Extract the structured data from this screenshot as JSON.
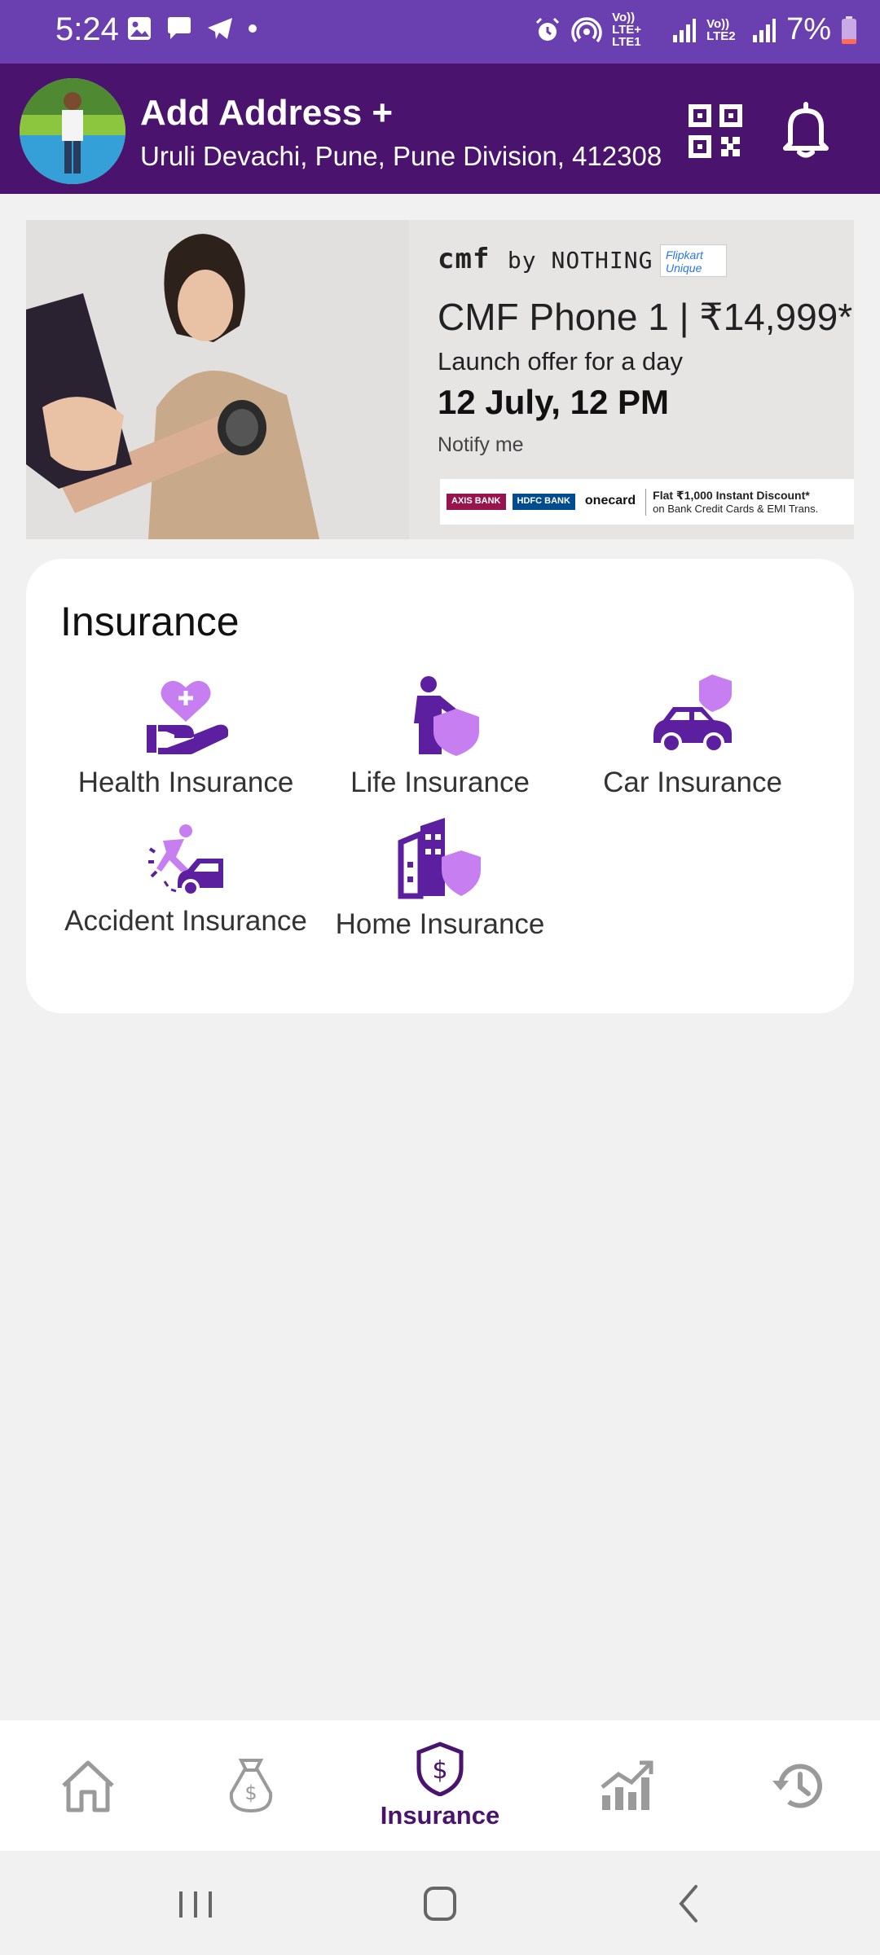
{
  "status_bar": {
    "time": "5:24",
    "network_1": "Vo)) LTE+ LTE1",
    "network_2": "Vo)) LTE2",
    "battery": "7%"
  },
  "header": {
    "title": "Add Address +",
    "address": "Uruli Devachi, Pune, Pune Division, 412308"
  },
  "banner": {
    "brand": "cmf",
    "brand_sub": "by NOTHING",
    "partner": "Flipkart Unique",
    "headline": "CMF Phone 1 | ₹14,999*",
    "subtitle": "Launch offer for a day",
    "date": "12 July, 12 PM",
    "notify": "Notify me",
    "banks": [
      "AXIS BANK",
      "HDFC BANK",
      "onecard"
    ],
    "offer_title": "Flat ₹1,000 Instant Discount*",
    "offer_sub": "on Bank Credit Cards & EMI Trans."
  },
  "insurance": {
    "title": "Insurance",
    "items": [
      {
        "label": "Health Insurance",
        "icon": "health-insurance-icon"
      },
      {
        "label": "Life Insurance",
        "icon": "life-insurance-icon"
      },
      {
        "label": "Car Insurance",
        "icon": "car-insurance-icon"
      },
      {
        "label": "Accident Insurance",
        "icon": "accident-insurance-icon"
      },
      {
        "label": "Home Insurance",
        "icon": "home-insurance-icon"
      }
    ]
  },
  "bottom_nav": {
    "items": [
      {
        "icon": "home-icon",
        "label": ""
      },
      {
        "icon": "money-bag-icon",
        "label": ""
      },
      {
        "icon": "shield-dollar-icon",
        "label": "Insurance"
      },
      {
        "icon": "chart-icon",
        "label": ""
      },
      {
        "icon": "history-icon",
        "label": ""
      }
    ],
    "active_index": 2
  },
  "colors": {
    "header_bg": "#4a136e",
    "status_bg": "#6a3fb0",
    "icon_dark": "#5b1fa0",
    "icon_light": "#c77ef0",
    "inactive_nav": "#9a9a9a"
  }
}
